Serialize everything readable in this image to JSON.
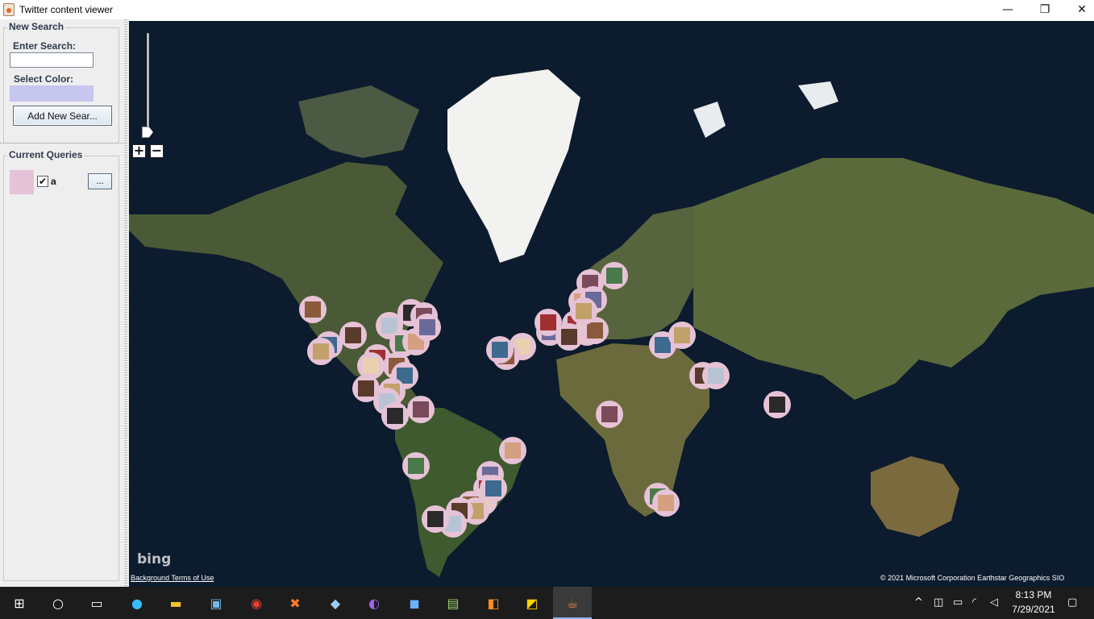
{
  "window": {
    "title": "Twitter content viewer",
    "min": "—",
    "max": "❐",
    "close": "✕"
  },
  "left_panel": {
    "new_search": {
      "group_title": "New Search",
      "search_label": "Enter Search:",
      "search_value": "",
      "color_label": "Select Color:",
      "color": "#c6c6ee",
      "add_button": "Add New Sear..."
    },
    "current_queries": {
      "group_title": "Current Queries",
      "items": [
        {
          "color": "#e6c2d6",
          "checked": "✔",
          "name": "a",
          "menu": "..."
        }
      ]
    }
  },
  "map": {
    "zoom_in": "+",
    "zoom_out": "−",
    "logo": "bing",
    "terms": "Background Terms of Use",
    "copyright": "© 2021 Microsoft Corporation Earthstar Geographics  SIO",
    "marker_color": "#e6c2d6",
    "tweet_markers": 52
  },
  "taskbar": {
    "icons": [
      "windows-start-icon",
      "search-circle-icon",
      "task-view-icon",
      "edge-icon",
      "file-explorer-icon",
      "control-panel-icon",
      "chrome-icon",
      "xampp-icon",
      "virtualbox-icon",
      "tor-browser-icon",
      "intellij-icon",
      "notepad-plus-icon",
      "pdf-tool-icon",
      "sticky-notes-icon",
      "java-icon"
    ],
    "time": "8:13 PM",
    "date": "7/29/2021"
  }
}
